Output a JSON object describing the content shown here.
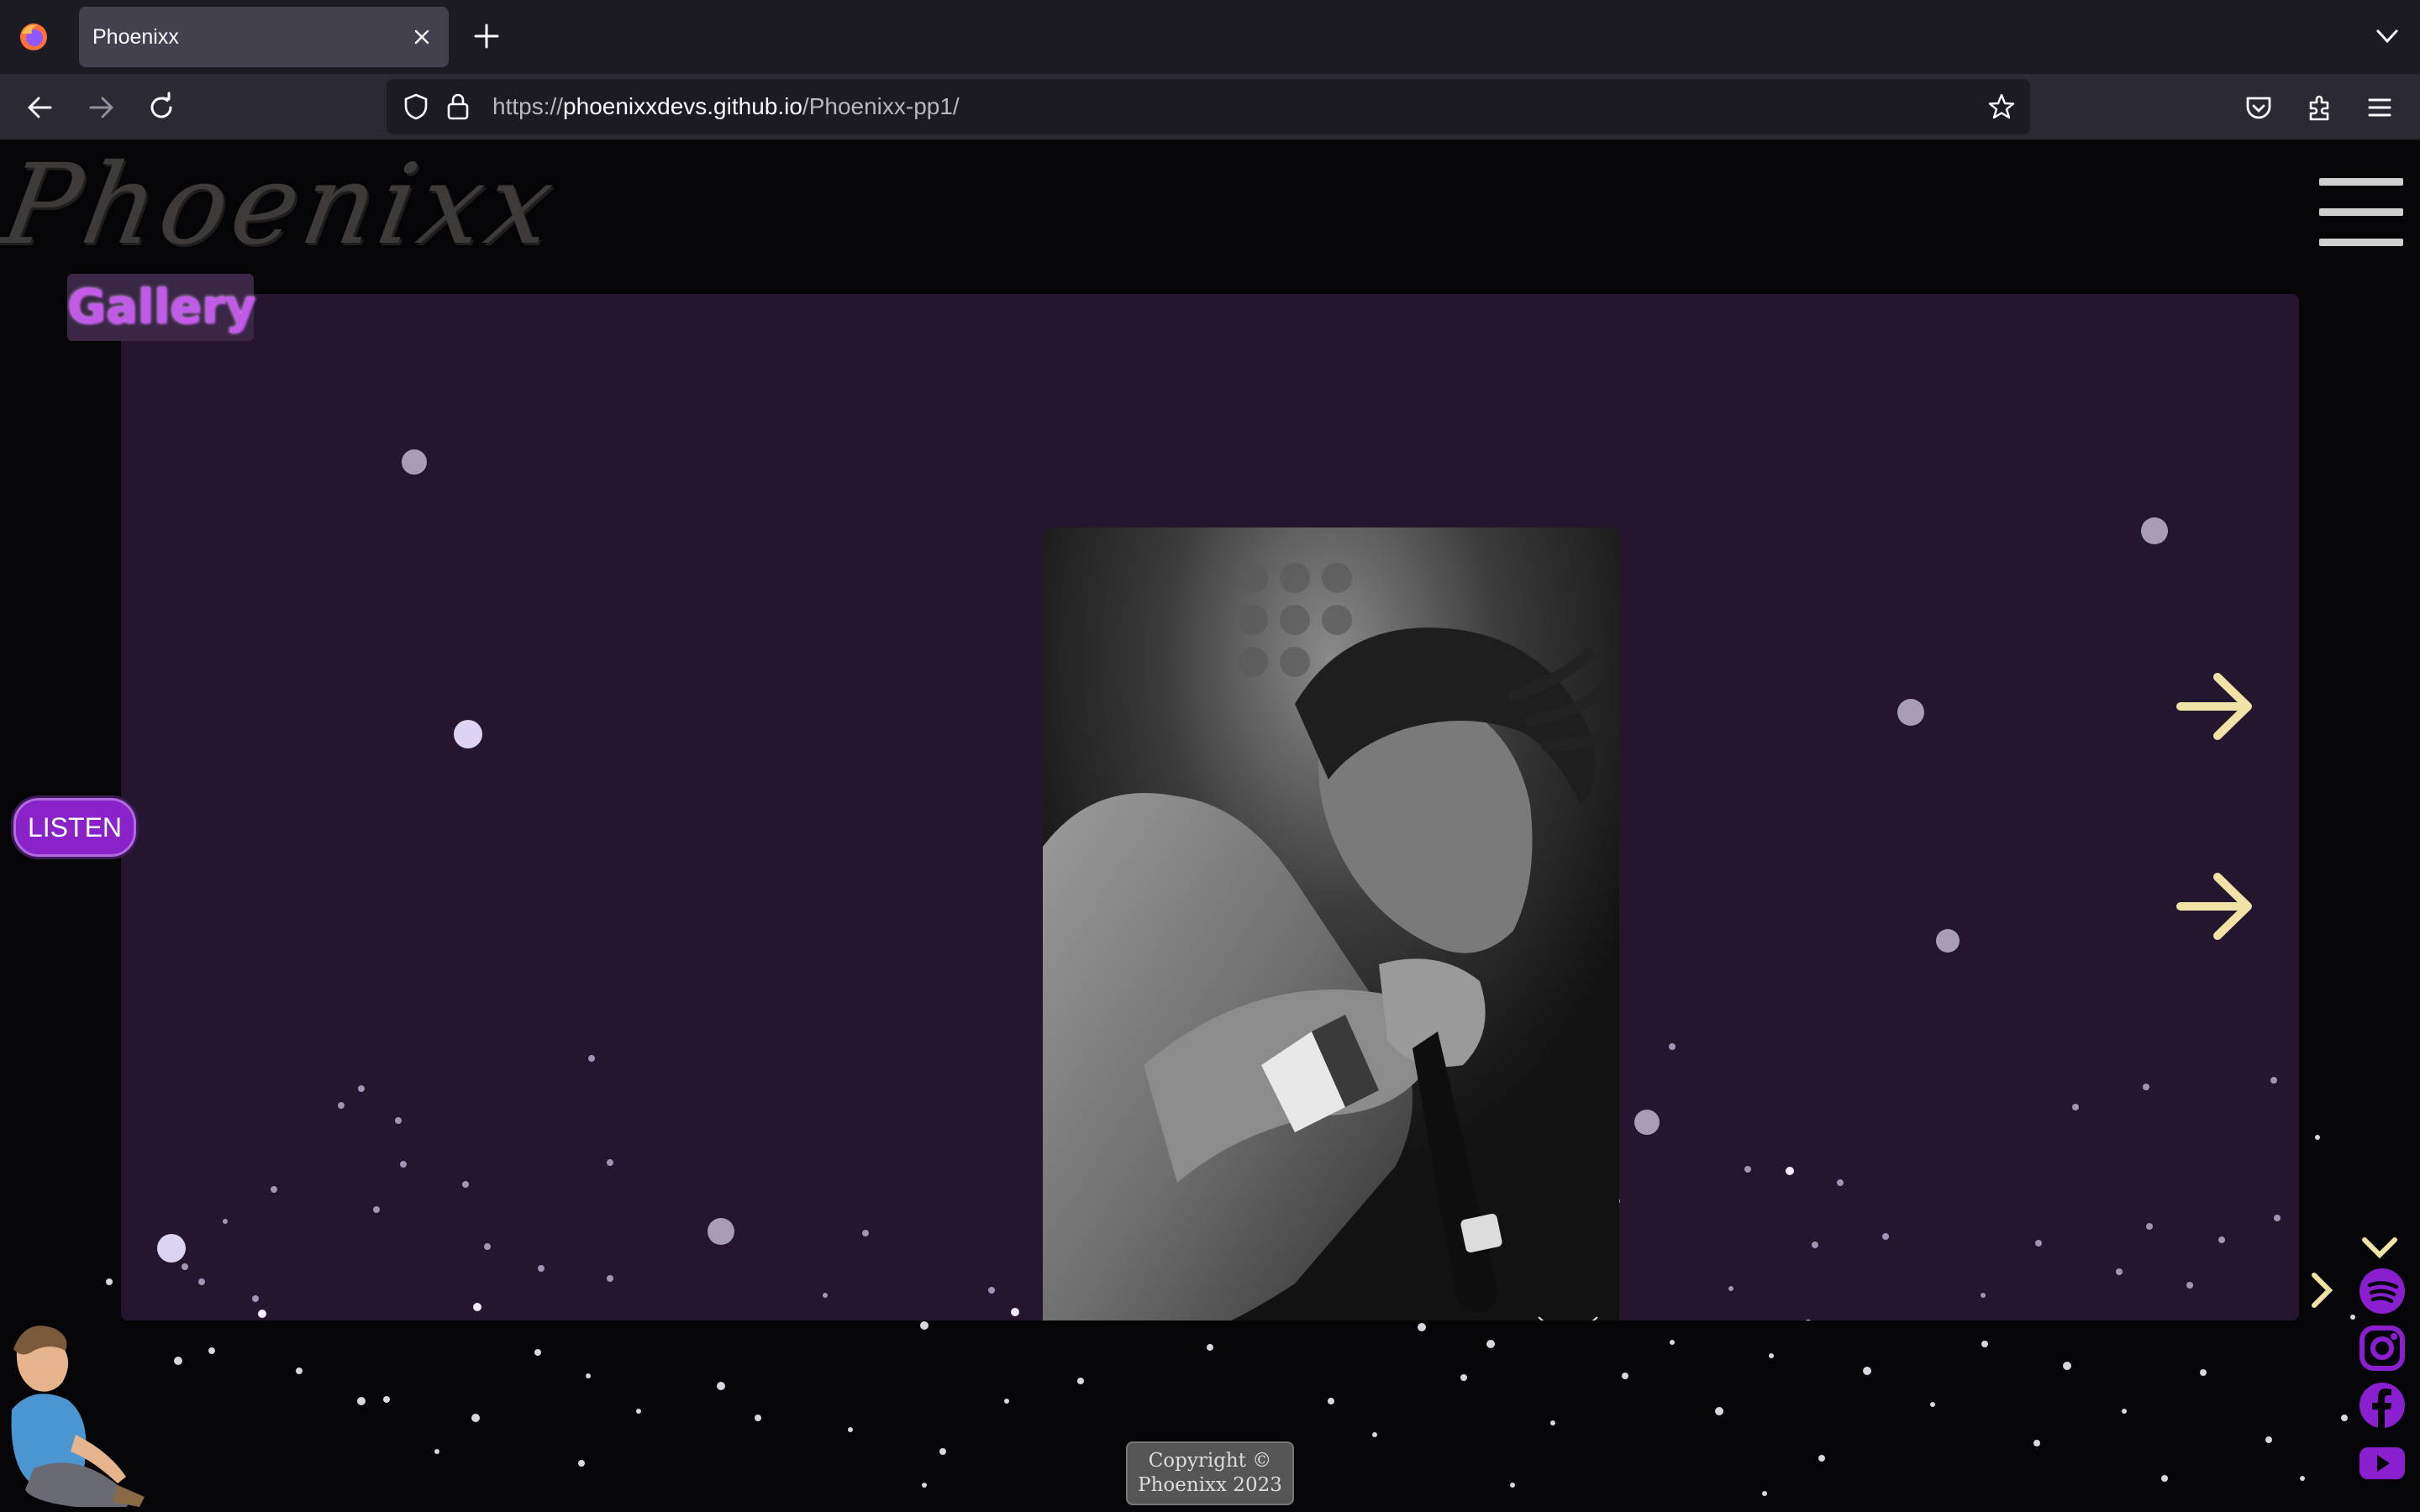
{
  "browser": {
    "tab_title": "Phoenixx",
    "url_prefix": "https://",
    "url_host": "phoenixxdevs.github.io",
    "url_path": "/Phoenixx-pp1/"
  },
  "page": {
    "logo_text": "Phoenixx",
    "section_title": "Gallery",
    "listen_label": "LISTEN",
    "copyright_line1": "Copyright ©",
    "copyright_line2": "Phoenixx 2023",
    "photo_description_icons": [
      "next-arrow-icon",
      "next-arrow-icon"
    ],
    "social_icons": [
      "spotify-icon",
      "instagram-icon",
      "facebook-icon",
      "youtube-icon"
    ],
    "colors": {
      "panel": "#24162e",
      "accent_purple": "#8a22c9",
      "social_purple": "#8a1fd0",
      "arrow_cream": "#f1e2a6"
    }
  }
}
